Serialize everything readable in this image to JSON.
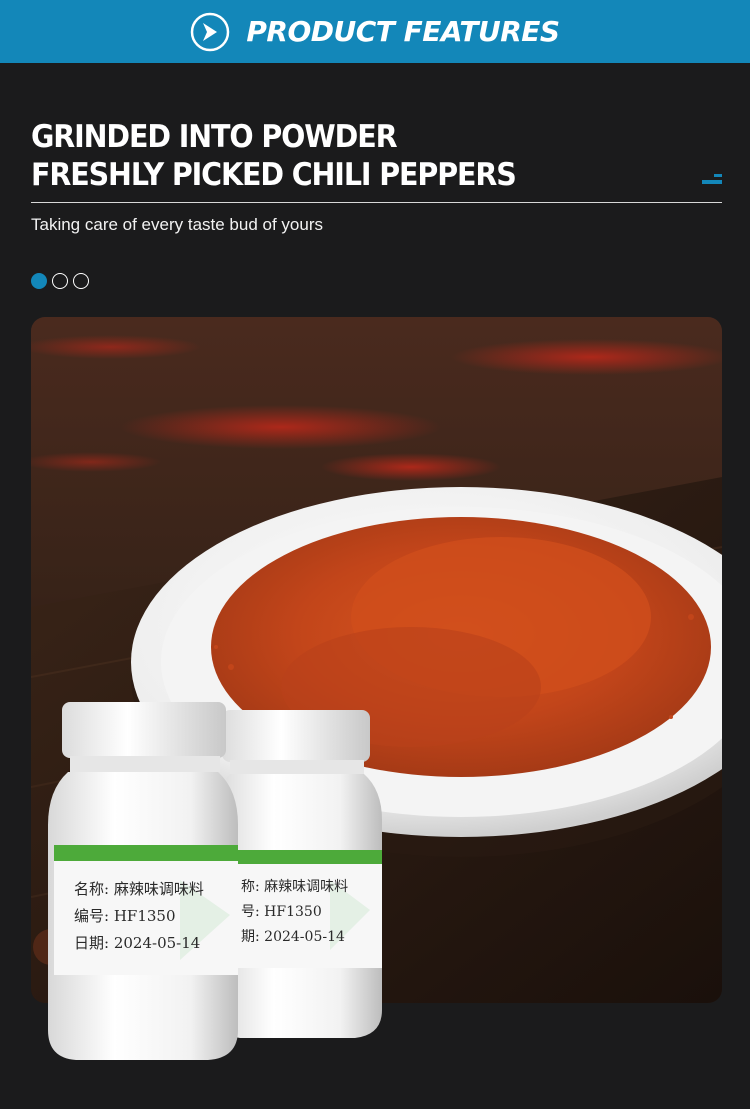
{
  "header": {
    "title": "PRODUCT FEATURES",
    "icon": "chevron-right-circle-icon",
    "color": "#1387b9"
  },
  "headline": {
    "line1": "GRINDED INTO POWDER",
    "line2": "FRESHLY PICKED CHILI PEPPERS"
  },
  "tagline": "Taking care of every taste bud of yours",
  "pagination": {
    "count": 3,
    "active": 0
  },
  "bottle_front": {
    "name_label": "名称:",
    "name_value": "麻辣味调味料",
    "code_label": "编号:",
    "code_value": "HF1350",
    "date_label": "日期:",
    "date_value": "2024-05-14"
  },
  "bottle_back": {
    "name_label": "称:",
    "name_value": "麻辣味调味料",
    "code_label": "号:",
    "code_value": "HF1350",
    "date_label": "期:",
    "date_value": "2024-05-14"
  },
  "colors": {
    "background": "#1b1b1c",
    "accent": "#1387b9",
    "chili": "#c2451a",
    "label_green": "#4daa3a"
  }
}
